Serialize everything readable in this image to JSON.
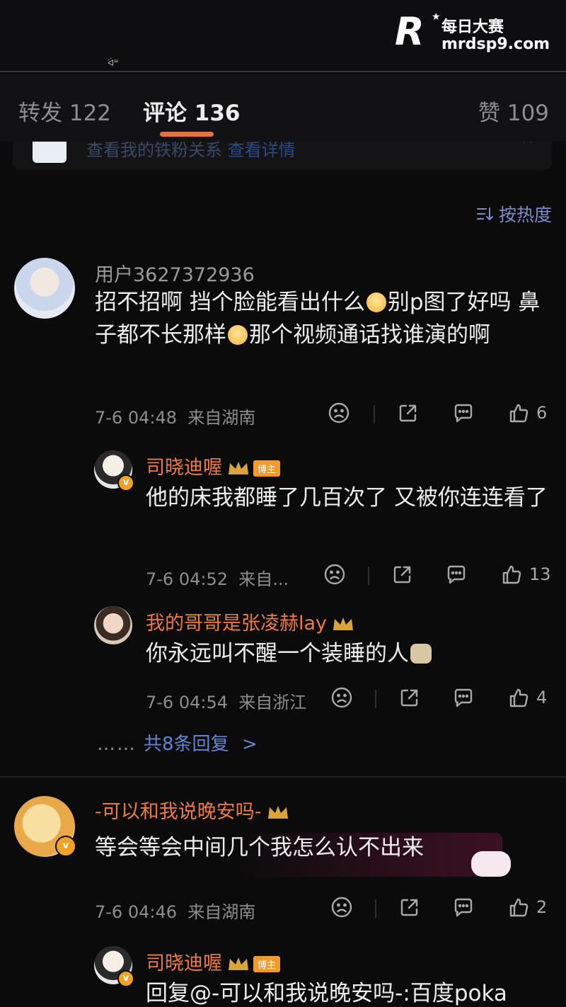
{
  "watermark": {
    "logo": "R",
    "name": "每日大赛",
    "url": "mrdsp9.com"
  },
  "top_glyph": "ᐛᐜ",
  "tabs": [
    {
      "label": "转发 122"
    },
    {
      "label": "评论 136"
    },
    {
      "label": "赞 109"
    }
  ],
  "banner": {
    "text": "查看我的铁粉关系",
    "link": "查看详情"
  },
  "sort_label": "按热度",
  "comments": [
    {
      "user": "用户3627372936",
      "text_parts": [
        "招不招啊 挡个脸能看出什么",
        "别p图了好吗 鼻子都不长那样",
        "那个视频通话找谁演的啊"
      ],
      "time": "7-6 04:48",
      "location": "来自湖南",
      "likes": "6"
    },
    {
      "user": "司晓迪喔",
      "tag": "博主",
      "text": "他的床我都睡了几百次了 又被你连连看了",
      "time": "7-6 04:52",
      "location": "来自...",
      "likes": "13"
    },
    {
      "user": "我的哥哥是张凌赫lay",
      "text": "你永远叫不醒一个装睡的人",
      "time": "7-6 04:54",
      "location": "来自浙江",
      "likes": "4"
    },
    {
      "user": "-可以和我说晚安吗-",
      "text": "等会等会中间几个我怎么认不出来",
      "time": "7-6 04:46",
      "location": "来自湖南",
      "likes": "2"
    },
    {
      "user": "司晓迪喔",
      "tag": "博主",
      "text": "回复@-可以和我说晚安吗-:百度poka"
    }
  ],
  "more_replies": {
    "dots": "……",
    "label": "共8条回复",
    "chevron": ">"
  },
  "colors": {
    "accent": "#e4733c",
    "username": "#f07a3c",
    "link": "#5f86d6"
  }
}
